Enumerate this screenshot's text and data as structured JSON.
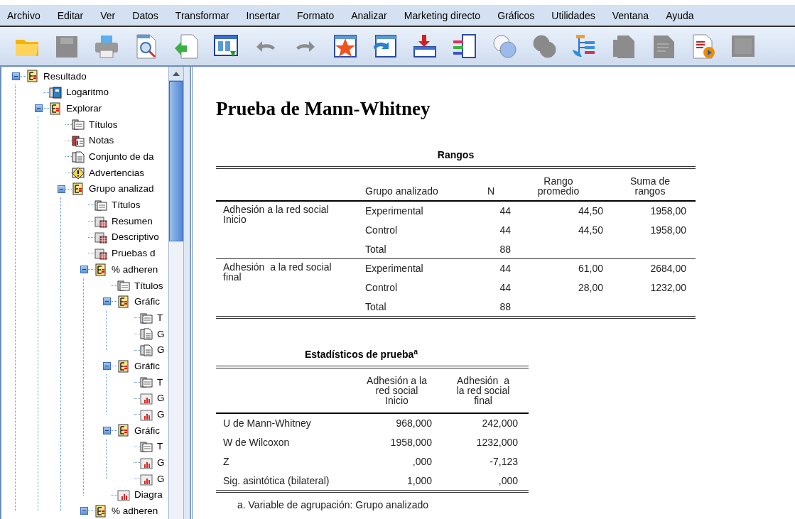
{
  "menu": [
    "Archivo",
    "Editar",
    "Ver",
    "Datos",
    "Transformar",
    "Insertar",
    "Formato",
    "Analizar",
    "Marketing directo",
    "Gráficos",
    "Utilidades",
    "Ventana",
    "Ayuda"
  ],
  "toolbar": [
    {
      "kind": "folder",
      "disabled": false
    },
    {
      "kind": "save",
      "disabled": true
    },
    {
      "kind": "print",
      "disabled": false
    },
    {
      "kind": "preview",
      "disabled": false
    },
    {
      "kind": "export",
      "disabled": false
    },
    {
      "kind": "data",
      "disabled": false
    },
    {
      "kind": "undo",
      "disabled": true
    },
    {
      "kind": "redo",
      "disabled": true
    },
    {
      "kind": "star",
      "disabled": false
    },
    {
      "kind": "refresh",
      "disabled": false
    },
    {
      "kind": "insert",
      "disabled": false
    },
    {
      "kind": "variables",
      "disabled": false
    },
    {
      "kind": "circles",
      "disabled": false
    },
    {
      "kind": "circles",
      "disabled": true
    },
    {
      "kind": "tree",
      "disabled": false
    },
    {
      "kind": "page",
      "disabled": true
    },
    {
      "kind": "doc",
      "disabled": true
    },
    {
      "kind": "play",
      "disabled": false
    },
    {
      "kind": "square",
      "disabled": true
    }
  ],
  "outline": [
    {
      "label": "Resultado",
      "kind": "book",
      "expanded": true,
      "children": [
        {
          "label": "Logaritmo",
          "kind": "log"
        },
        {
          "label": "Explorar",
          "kind": "book",
          "expanded": true,
          "children": [
            {
              "label": "Títulos",
              "kind": "title"
            },
            {
              "label": "Notas",
              "kind": "notes"
            },
            {
              "label": "Conjunto de da",
              "kind": "page"
            },
            {
              "label": "Advertencias",
              "kind": "warning"
            },
            {
              "label": "Grupo analizad",
              "kind": "book",
              "expanded": true,
              "children": [
                {
                  "label": "Títulos",
                  "kind": "title"
                },
                {
                  "label": "Resumen",
                  "kind": "table"
                },
                {
                  "label": "Descriptivo",
                  "kind": "table"
                },
                {
                  "label": "Pruebas d",
                  "kind": "table"
                },
                {
                  "label": "% adheren",
                  "kind": "book",
                  "expanded": true,
                  "children": [
                    {
                      "label": "Títulos",
                      "kind": "title"
                    },
                    {
                      "label": "Gráfic",
                      "kind": "book",
                      "expanded": true,
                      "children": [
                        {
                          "label": "T",
                          "kind": "title"
                        },
                        {
                          "label": "G",
                          "kind": "page"
                        },
                        {
                          "label": "G",
                          "kind": "page"
                        }
                      ]
                    },
                    {
                      "label": "Gráfic",
                      "kind": "book",
                      "expanded": true,
                      "children": [
                        {
                          "label": "T",
                          "kind": "title"
                        },
                        {
                          "label": "G",
                          "kind": "chart"
                        },
                        {
                          "label": "G",
                          "kind": "chart"
                        }
                      ]
                    },
                    {
                      "label": "Gráfic",
                      "kind": "book",
                      "expanded": true,
                      "children": [
                        {
                          "label": "T",
                          "kind": "title"
                        },
                        {
                          "label": "G",
                          "kind": "chart"
                        },
                        {
                          "label": "G",
                          "kind": "chart"
                        }
                      ]
                    },
                    {
                      "label": "Diagra",
                      "kind": "chart"
                    }
                  ]
                },
                {
                  "label": "% adheren",
                  "kind": "book",
                  "expanded": true
                }
              ]
            }
          ]
        }
      ]
    }
  ],
  "viewer": {
    "title": "Prueba de Mann-Whitney",
    "ranks_table": {
      "title": "Rangos",
      "columns": {
        "group": "Grupo analizado",
        "n": "N",
        "mean_rank": "Rango promedio",
        "sum_ranks": "Suma de rangos"
      },
      "sections": [
        {
          "variable": "Adhesión a la red social Inicio",
          "rows": [
            {
              "group": "Experimental",
              "n": "44",
              "mean_rank": "44,50",
              "sum_ranks": "1958,00"
            },
            {
              "group": "Control",
              "n": "44",
              "mean_rank": "44,50",
              "sum_ranks": "1958,00"
            },
            {
              "group": "Total",
              "n": "88"
            }
          ]
        },
        {
          "variable": "Adhesión  a la red social final",
          "rows": [
            {
              "group": "Experimental",
              "n": "44",
              "mean_rank": "61,00",
              "sum_ranks": "2684,00"
            },
            {
              "group": "Control",
              "n": "44",
              "mean_rank": "28,00",
              "sum_ranks": "1232,00"
            },
            {
              "group": "Total",
              "n": "88"
            }
          ]
        }
      ]
    },
    "stats_table": {
      "title": "Estadísticos de prueba$^{a}$",
      "columns": [
        "Adhesión a la red social Inicio",
        "Adhesión  a la red social final"
      ],
      "rows": [
        {
          "label": "U de Mann-Whitney",
          "values": [
            "968,000",
            "242,000"
          ]
        },
        {
          "label": "W de Wilcoxon",
          "values": [
            "1958,000",
            "1232,000"
          ]
        },
        {
          "label": "Z",
          "values": [
            ",000",
            "-7,123"
          ]
        },
        {
          "label": "Sig. asintótica (bilateral)",
          "values": [
            "1,000",
            ",000"
          ]
        }
      ],
      "footnote": "a. Variable de agrupación: Grupo analizado"
    }
  }
}
